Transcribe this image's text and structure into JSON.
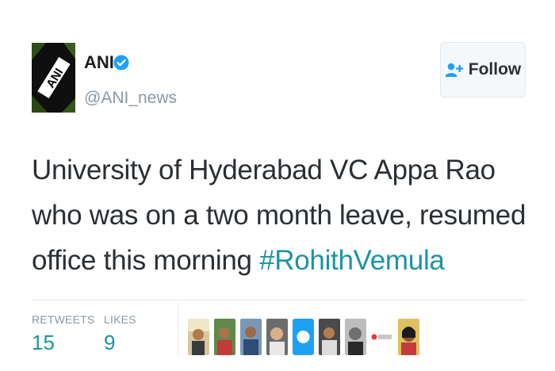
{
  "author": {
    "name": "ANI",
    "handle": "@ANI_news",
    "avatar_text": "ANI"
  },
  "follow": {
    "label": "Follow",
    "icon": "follow-user-plus-icon"
  },
  "tweet": {
    "text": "University of Hyderabad VC Appa Rao who was on a two month leave, resumed office this morning ",
    "hashtag": "#RohithVemula"
  },
  "stats": {
    "retweets_label": "RETWEETS",
    "retweets": "15",
    "likes_label": "LIKES",
    "likes": "9"
  },
  "colors": {
    "accent": "#1b95a0",
    "verified": "#1da1f2",
    "follow_icon": "#1da1f2",
    "muted": "#8899a6"
  }
}
